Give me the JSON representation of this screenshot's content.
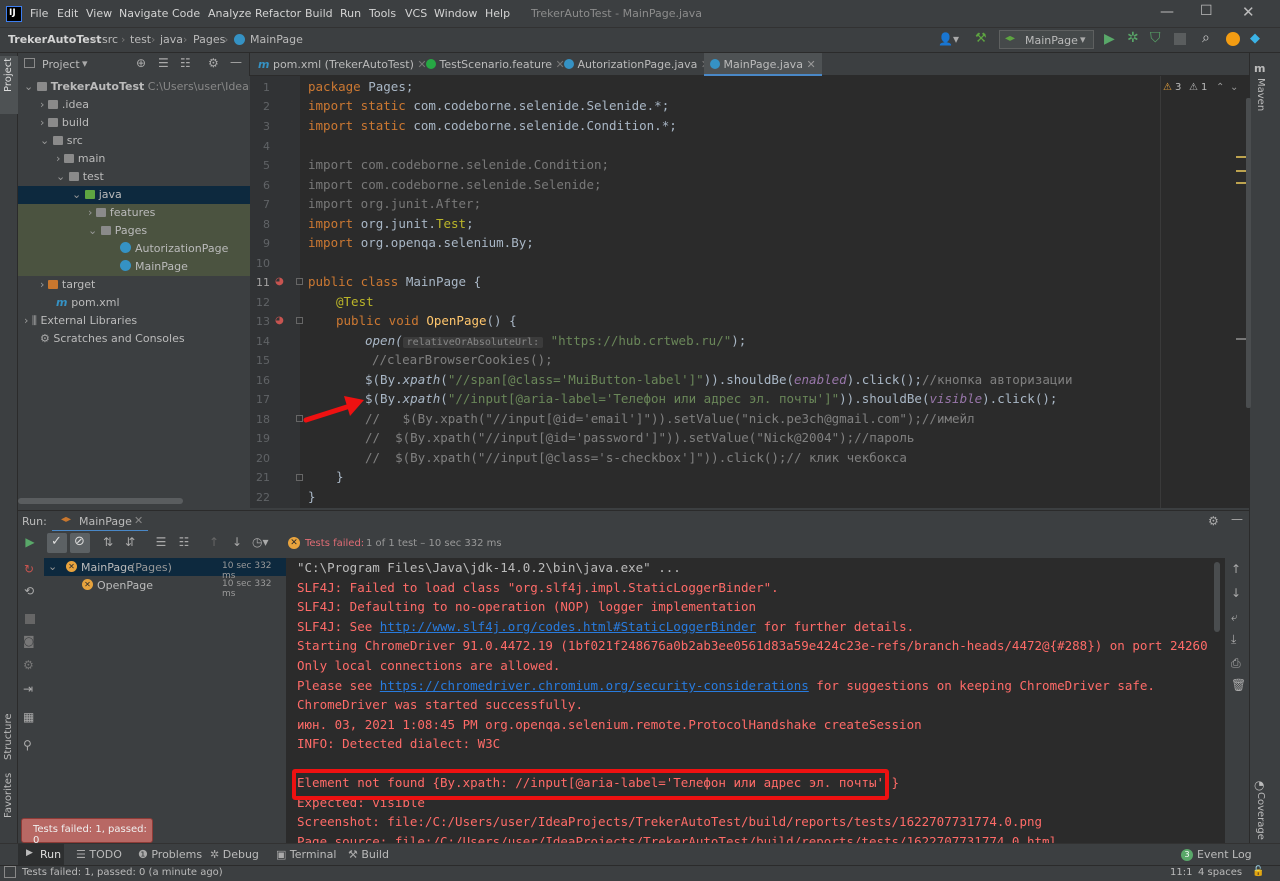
{
  "menu": {
    "items": [
      "File",
      "Edit",
      "View",
      "Navigate",
      "Code",
      "Analyze",
      "Refactor",
      "Build",
      "Run",
      "Tools",
      "VCS",
      "Window",
      "Help"
    ],
    "window_title": "TrekerAutoTest - MainPage.java"
  },
  "breadcrumb": [
    "TrekerAutoTest",
    "src",
    "test",
    "java",
    "Pages",
    "MainPage"
  ],
  "run_config": "MainPage",
  "tabs": [
    "pom.xml (TrekerAutoTest)",
    "TestScenario.feature",
    "AutorizationPage.java",
    "MainPage.java"
  ],
  "project": {
    "header": "Project",
    "tree": [
      {
        "label": "TrekerAutoTest",
        "sub": "C:\\Users\\user\\IdeaProje"
      },
      {
        "label": ".idea"
      },
      {
        "label": "build"
      },
      {
        "label": "src"
      },
      {
        "label": "main"
      },
      {
        "label": "test"
      },
      {
        "label": "java"
      },
      {
        "label": "features"
      },
      {
        "label": "Pages"
      },
      {
        "label": "AutorizationPage"
      },
      {
        "label": "MainPage"
      },
      {
        "label": "target"
      },
      {
        "label": "pom.xml"
      },
      {
        "label": "External Libraries"
      },
      {
        "label": "Scratches and Consoles"
      }
    ]
  },
  "editor": {
    "line_numbers": [
      "1",
      "2",
      "3",
      "4",
      "5",
      "6",
      "7",
      "8",
      "9",
      "10",
      "11",
      "12",
      "13",
      "14",
      "15",
      "16",
      "17",
      "18",
      "19",
      "20",
      "21",
      "22"
    ],
    "inspections": {
      "warnings": "3",
      "weak": "1"
    },
    "hint": "relativeOrAbsoluteUrl:",
    "code": {
      "l1a": "package ",
      "l1b": "Pages;",
      "l2a": "import static ",
      "l2b": "com.codeborne.selenide.Selenide.*;",
      "l3a": "import static ",
      "l3b": "com.codeborne.selenide.Condition.*;",
      "l5": "import com.codeborne.selenide.Condition;",
      "l6": "import com.codeborne.selenide.Selenide;",
      "l7": "import org.junit.After;",
      "l8a": "import ",
      "l8b": "org.junit.",
      "l8c": "Test",
      ";": ";",
      "l9a": "import ",
      "l9b": "org.openqa.selenium.By;",
      "l11a": "public class ",
      "l11b": "MainPage {",
      "l12": "@Test",
      "l13a": "public void ",
      "l13b": "OpenPage",
      "l13c": "() {",
      "l14a": "open(",
      "l14b": "\"https://hub.crtweb.ru/\"",
      "l14c": ");",
      "l15": "//clearBrowserCookies();",
      "l16a": "$(By.",
      "l16b": "xpath",
      "l16c": "(",
      "l16d": "\"//span[@class='MuiButton-label']\"",
      "l16e": ")).shouldBe(",
      "l16f": "enabled",
      "l16g": ").click();",
      "l16h": "//кнопка авторизации",
      "l17a": "$(By.",
      "l17b": "xpath",
      "l17c": "(",
      "l17d": "\"//input[@aria-label='Телефон или адрес эл. почты']\"",
      "l17e": ")).shouldBe(",
      "l17f": "visible",
      "l17g": ").click();",
      "l18": "//   $(By.xpath(\"//input[@id='email']\")).setValue(\"nick.pe3ch@gmail.com\");//имейл",
      "l19": "//  $(By.xpath(\"//input[@id='password']\")).setValue(\"Nick@2004\");//пароль",
      "l20": "//  $(By.xpath(\"//input[@class='s-checkbox']\")).click();// клик чекбокса",
      "l21": "}",
      "l22": "}"
    }
  },
  "run": {
    "label": "Run:",
    "tab": "MainPage",
    "status": "Tests failed:",
    "status_detail": "1 of 1 test – 10 sec 332 ms",
    "tree": [
      {
        "label": "MainPage",
        "sub": "(Pages)",
        "time": "10 sec 332 ms"
      },
      {
        "label": "OpenPage",
        "time": "10 sec 332 ms"
      }
    ],
    "console": [
      "\"C:\\Program Files\\Java\\jdk-14.0.2\\bin\\java.exe\" ...",
      "SLF4J: Failed to load class \"org.slf4j.impl.StaticLoggerBinder\".",
      "SLF4J: Defaulting to no-operation (NOP) logger implementation",
      "SLF4J: See ",
      "http://www.slf4j.org/codes.html#StaticLoggerBinder",
      " for further details.",
      "Starting ChromeDriver 91.0.4472.19 (1bf021f248676a0b2ab3ee0561d83a59e424c23e-refs/branch-heads/4472@{#288}) on port 24260",
      "Only local connections are allowed.",
      "Please see ",
      "https://chromedriver.chromium.org/security-considerations",
      " for suggestions on keeping ChromeDriver safe.",
      "ChromeDriver was started successfully.",
      "июн. 03, 2021 1:08:45 PM org.openqa.selenium.remote.ProtocolHandshake createSession",
      "INFO: Detected dialect: W3C",
      "Element not found {By.xpath: //input[@aria-label='Телефон или адрес эл. почты']}",
      "Expected: visible",
      "Screenshot: file:/C:/Users/user/IdeaProjects/TrekerAutoTest/build/reports/tests/1622707731774.0.png",
      "Page source: file:/C:/Users/user/IdeaProjects/TrekerAutoTest/build/reports/tests/1622707731774.0.html"
    ]
  },
  "tooltip": "Tests failed: 1, passed: 0",
  "bottom_tools": [
    "Run",
    "TODO",
    "Problems",
    "Debug",
    "Terminal",
    "Build"
  ],
  "event_log": "Event Log",
  "event_count": "3",
  "status": {
    "text": "Tests failed: 1, passed: 0 (a minute ago)",
    "pos": "11:1",
    "indent": "4 spaces"
  },
  "side_labels": {
    "project": "Project",
    "structure": "Structure",
    "favorites": "Favorites",
    "maven": "Maven",
    "coverage": "Coverage"
  },
  "colors": {
    "accent": "#4a88c7",
    "error": "#ff6b68",
    "highlight_box": "#ff0000"
  }
}
